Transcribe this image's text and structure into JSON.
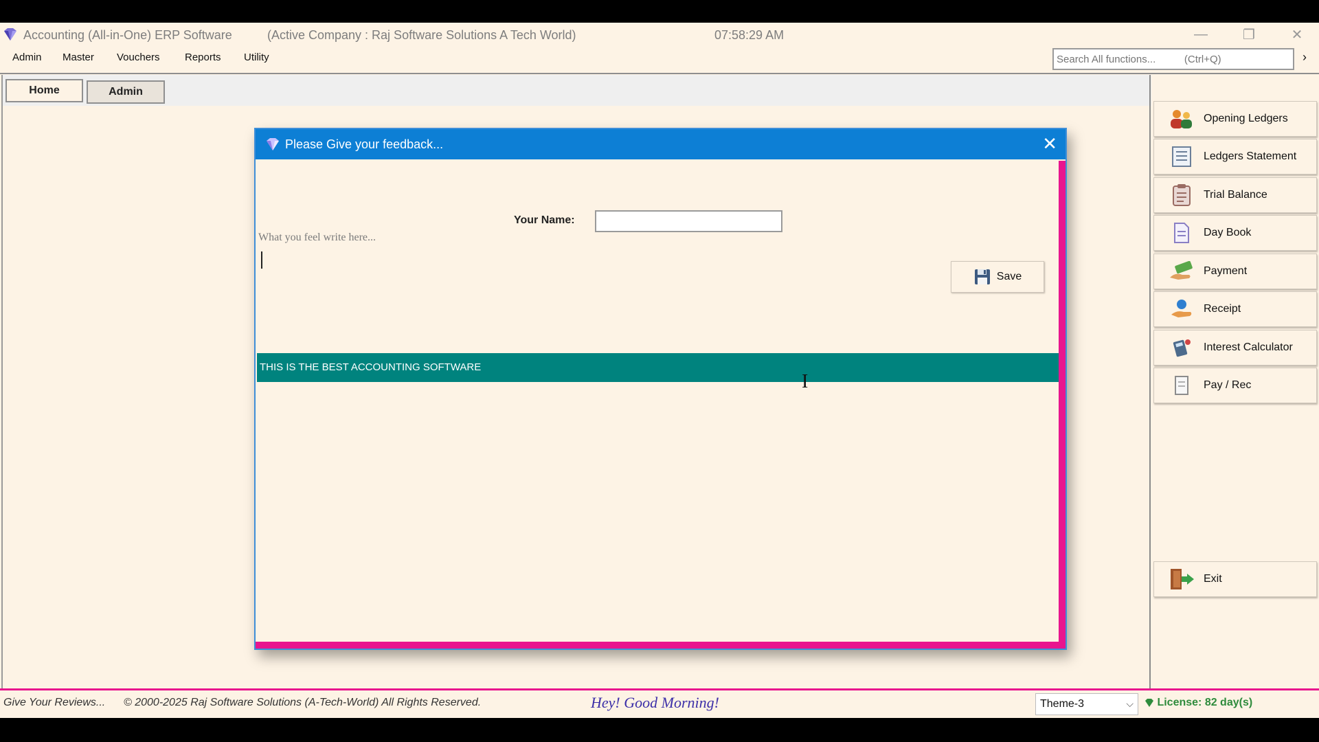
{
  "window": {
    "app_title": "Accounting (All-in-One) ERP Software",
    "active_company": "(Active Company :  Raj Software Solutions A Tech World)",
    "clock": "07:58:29 AM",
    "minimize_glyph": "—",
    "maximize_glyph": "❐",
    "close_glyph": "✕"
  },
  "menu": {
    "items": [
      "Admin",
      "Master",
      "Vouchers",
      "Reports",
      "Utility"
    ]
  },
  "search": {
    "placeholder": "Search All functions...          (Ctrl+Q)",
    "arrow": "›"
  },
  "tabs": {
    "home": "Home",
    "admin": "Admin"
  },
  "sidebar": {
    "items": [
      {
        "label": "Opening Ledgers",
        "icon": "people-icon"
      },
      {
        "label": "Ledgers Statement",
        "icon": "ledger-sheet-icon"
      },
      {
        "label": "Trial Balance",
        "icon": "clipboard-icon"
      },
      {
        "label": "Day Book",
        "icon": "document-icon"
      },
      {
        "label": "Payment",
        "icon": "money-hand-icon"
      },
      {
        "label": "Receipt",
        "icon": "coin-hand-icon"
      },
      {
        "label": "Interest Calculator",
        "icon": "calculator-icon"
      },
      {
        "label": "Pay / Rec",
        "icon": "page-icon"
      }
    ],
    "exit_label": "Exit"
  },
  "dialog": {
    "title": "Please Give your feedback...",
    "close_glyph": "✕",
    "name_label": "Your Name:",
    "name_value": "",
    "feedback_placeholder": "What you feel write here...",
    "save_label": "Save",
    "banner_text": "THIS IS THE BEST ACCOUNTING SOFTWARE",
    "cursor_glyph": "I"
  },
  "status": {
    "reviews": "Give Your Reviews...",
    "copyright": "© 2000-2025 Raj Software Solutions (A-Tech-World) All Rights Reserved.",
    "greeting": "Hey! Good Morning!",
    "theme": "Theme-3",
    "theme_chevron": "⌵",
    "license": "License: 82 day(s)"
  },
  "colors": {
    "background": "#fdf3e5",
    "dialog_title": "#0d7fd5",
    "accent_pink": "#e8158e",
    "banner_teal": "#00837e",
    "greeting_text": "#3c2fa8",
    "license_text": "#2e8b3c"
  }
}
